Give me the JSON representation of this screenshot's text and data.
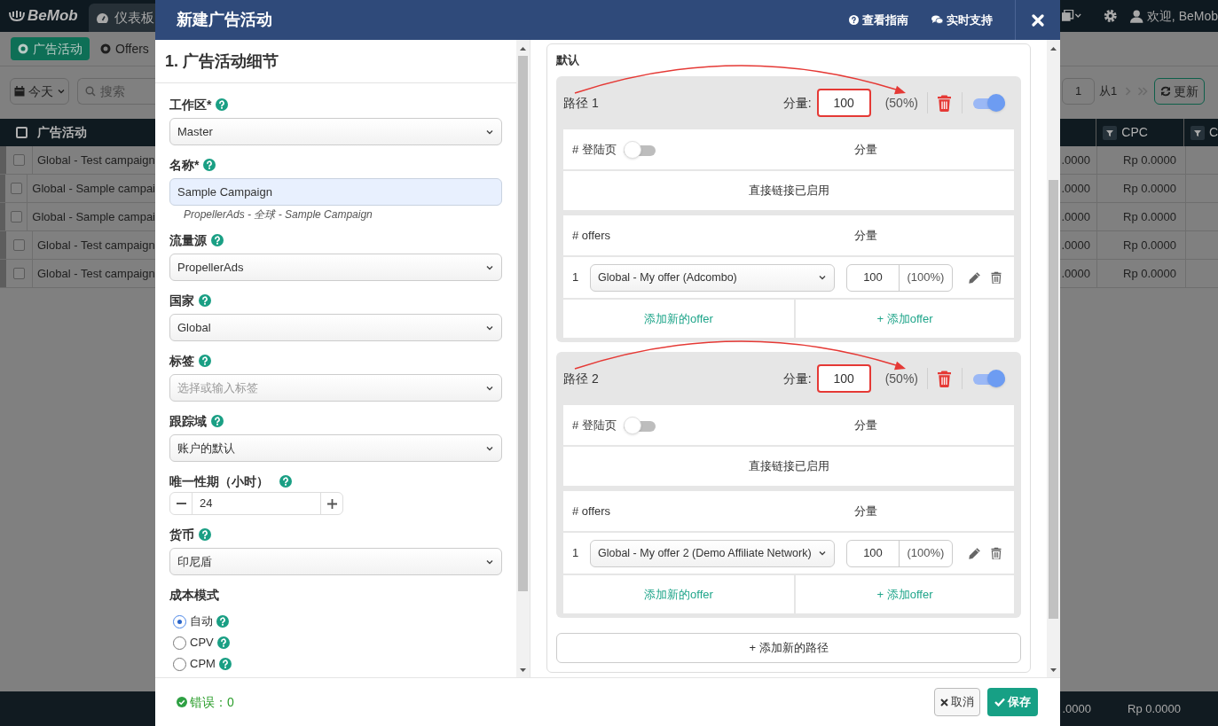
{
  "app": {
    "logo": "BeMob",
    "nav_tab": "仪表板",
    "user": "欢迎, BeMob"
  },
  "toolbar": {
    "tabs": [
      {
        "label": "广告活动",
        "selected": true
      },
      {
        "label": "Offers",
        "selected": false
      }
    ]
  },
  "filters": {
    "date": "今天",
    "search_placeholder": "搜索",
    "page": "1",
    "page_of": "从1",
    "refresh": "更新"
  },
  "table": {
    "columns": [
      "广告活动",
      "CPC",
      "C"
    ],
    "all_checked": false,
    "rows": [
      {
        "name": "Global - Test campaign",
        "checked": false,
        "column_2": ".0000",
        "cpc": "Rp 0.0000"
      },
      {
        "name": "Global - Sample campai",
        "checked": false,
        "column_2": ".0000",
        "cpc": "Rp 0.0000"
      },
      {
        "name": "Global - Sample campai",
        "checked": false,
        "column_2": ".0000",
        "cpc": "Rp 0.0000"
      },
      {
        "name": "Global - Test campaign",
        "checked": false,
        "column_2": ".0000",
        "cpc": "Rp 0.0000"
      },
      {
        "name": "Global - Test campaign",
        "checked": false,
        "column_2": ".0000",
        "cpc": "Rp 0.0000"
      }
    ],
    "totals": {
      "column_2": ".0000",
      "cpc": "Rp 0.0000"
    }
  },
  "modal": {
    "title": "新建广告活动",
    "links": [
      "查看指南",
      "实时支持"
    ],
    "section_title": "1. 广告活动细节",
    "fields": [
      {
        "kind": "select",
        "label": "工作区*",
        "value": "Master"
      },
      {
        "kind": "text",
        "label": "名称*",
        "value": "Sample Campaign",
        "hint": "PropellerAds - 全球 - Sample Campaign"
      },
      {
        "kind": "select",
        "label": "流量源",
        "value": "PropellerAds"
      },
      {
        "kind": "select",
        "label": "国家",
        "value": "Global"
      },
      {
        "kind": "select",
        "label": "标签",
        "placeholder": "选择或输入标签"
      },
      {
        "kind": "select",
        "label": "跟踪域",
        "value": "账户的默认"
      },
      {
        "kind": "stepper",
        "label": "唯一性期（小时）",
        "value": "24"
      },
      {
        "kind": "select",
        "label": "货币",
        "value": "印尼盾"
      },
      {
        "kind": "radio",
        "label": "成本模式",
        "options": [
          {
            "label": "自动",
            "selected": true
          },
          {
            "label": "CPV",
            "selected": false
          },
          {
            "label": "CPM",
            "selected": false
          }
        ]
      }
    ],
    "errors": "错误：0",
    "buttons": [
      {
        "kind": "cancel",
        "label": "取消"
      },
      {
        "kind": "save",
        "label": "保存"
      }
    ],
    "flow": {
      "title": "默认",
      "paths": [
        {
          "name": "路径 1",
          "weight_label": "分量:",
          "weight": "100",
          "highlighted": true,
          "annotated": true,
          "share": "(50%)",
          "enabled": true,
          "landers": {
            "label": "# 登陆页",
            "on": false,
            "weight_label": "分量",
            "note": "直接链接已启用"
          },
          "offers": {
            "label": "# offers",
            "weight_label": "分量",
            "items": [
              {
                "index": "1",
                "name": "Global - My offer (Adcombo)",
                "weight": "100",
                "share": "(100%)"
              }
            ],
            "actions": [
              "添加新的offer",
              "+ 添加offer"
            ]
          }
        },
        {
          "name": "路径 2",
          "weight_label": "分量:",
          "weight": "100",
          "highlighted": true,
          "annotated": true,
          "share": "(50%)",
          "enabled": true,
          "landers": {
            "label": "# 登陆页",
            "on": false,
            "weight_label": "分量",
            "note": "直接链接已启用"
          },
          "offers": {
            "label": "# offers",
            "weight_label": "分量",
            "items": [
              {
                "index": "1",
                "name": "Global - My offer 2 (Demo Affiliate Network)",
                "weight": "100",
                "share": "(100%)"
              }
            ],
            "actions": [
              "添加新的offer",
              "+ 添加offer"
            ]
          }
        }
      ],
      "add_path": "+ 添加新的路径"
    }
  }
}
